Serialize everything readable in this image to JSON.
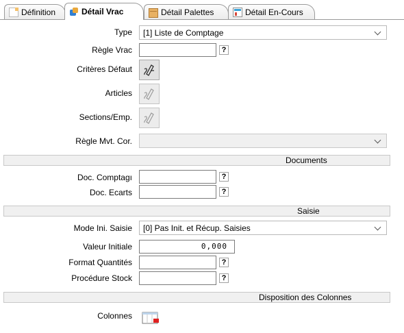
{
  "tabs": [
    {
      "label": "Définition",
      "icon": "document-icon"
    },
    {
      "label": "Détail Vrac",
      "icon": "bulk-items-icon",
      "active": true
    },
    {
      "label": "Détail Palettes",
      "icon": "pallet-icon"
    },
    {
      "label": "Détail En-Cours",
      "icon": "in-progress-icon"
    }
  ],
  "form": {
    "type": {
      "label": "Type",
      "value": "[1] Liste de Comptage"
    },
    "regle_vrac": {
      "label": "Règle Vrac",
      "value": "",
      "help": "?"
    },
    "criteres_defaut": {
      "label": "Critères Défaut"
    },
    "articles": {
      "label": "Articles"
    },
    "sections": {
      "label": "Sections/Emp."
    },
    "regle_mvt": {
      "label": "Règle Mvt. Cor.",
      "value": ""
    }
  },
  "documents": {
    "header": "Documents",
    "doc_comptage": {
      "label": "Doc. Comptagı",
      "value": "",
      "help": "?"
    },
    "doc_ecarts": {
      "label": "Doc. Ecarts",
      "value": "",
      "help": "?"
    }
  },
  "saisie": {
    "header": "Saisie",
    "mode_ini": {
      "label": "Mode Ini. Saisie",
      "value": "[0] Pas Init. et Récup. Saisies"
    },
    "valeur_initiale": {
      "label": "Valeur Initiale",
      "value": "0,000"
    },
    "format_quantites": {
      "label": "Format Quantités",
      "value": "",
      "help": "?"
    },
    "procedure_stock": {
      "label": "Procédure Stock",
      "value": "",
      "help": "?"
    }
  },
  "disposition": {
    "header": "Disposition des Colonnes",
    "colonnes": {
      "label": "Colonnes"
    }
  },
  "colors": {
    "section_bg": "#f0f0f0",
    "border": "#b9b9b9",
    "accent_red": "#e02020"
  }
}
